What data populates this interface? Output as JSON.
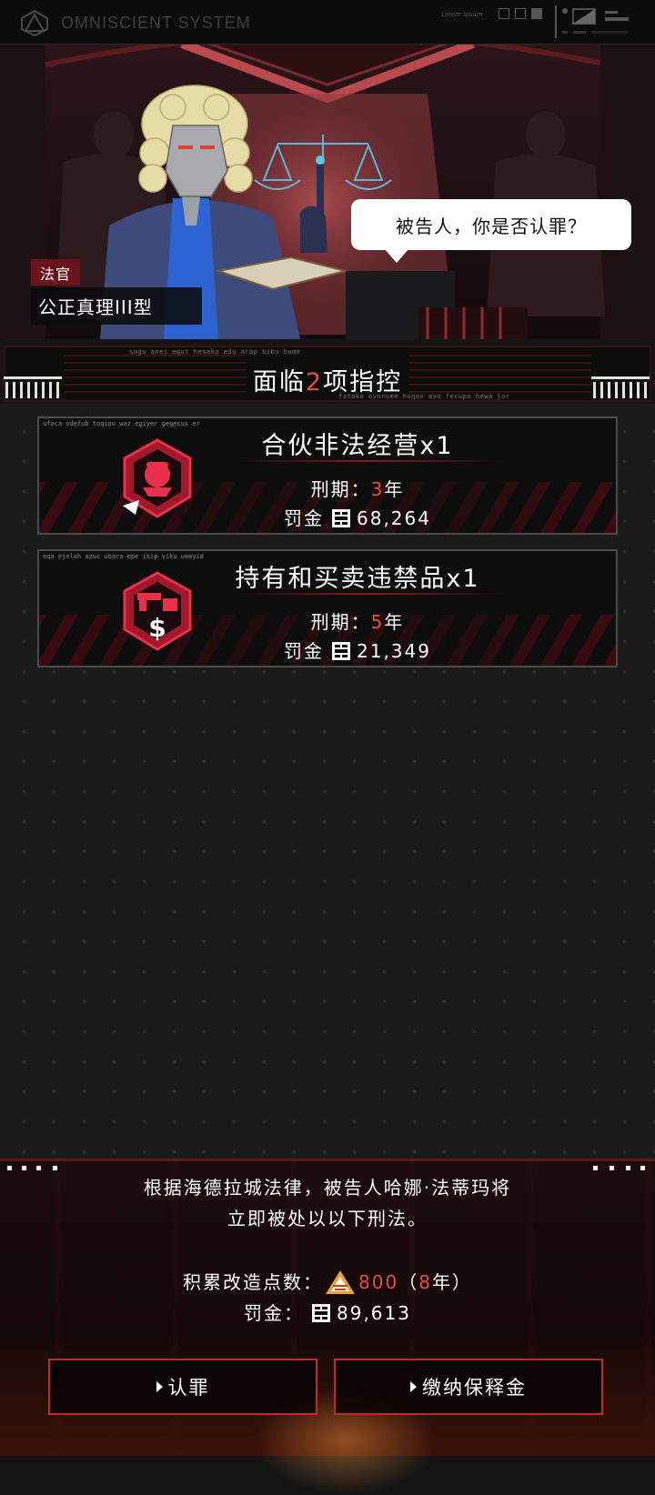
{
  "topbar": {
    "system_name": "OMNISCIENT SYSTEM",
    "lorem": "Lorem Ipsum"
  },
  "scene": {
    "speech": "被告人，你是否认罪？",
    "judge_role": "法官",
    "judge_name": "公正真理III型"
  },
  "charges_banner": {
    "prefix": "面临",
    "count": "2",
    "suffix": "项指控",
    "tiny_top": "sogu anej egut henaka edu arop bibu bume",
    "tiny_bottom": "fatoko ovorume hoqov evo fecupo hewa jor"
  },
  "charges": [
    {
      "tiny": "ufoca odefub toqipo waz egiyer gegecus er",
      "title": "合伙非法经营x1",
      "term_label": "刑期：",
      "term_years": "3",
      "term_unit": "年",
      "fine_label": "罚金",
      "fine_value": "68,264",
      "icon": "handshake-hex-icon"
    },
    {
      "tiny": "eqa ejeloh azuc ubara epe ikip viku uxeyid",
      "title": "持有和买卖违禁品x1",
      "term_label": "刑期：",
      "term_years": "5",
      "term_unit": "年",
      "fine_label": "罚金",
      "fine_value": "21,349",
      "icon": "contraband-hex-icon"
    }
  ],
  "verdict": {
    "line1": "根据海德拉城法律，被告人哈娜·法蒂玛将",
    "line2": "立即被处以以下刑法。",
    "points_label": "积累改造点数：",
    "points_value": "800",
    "points_open": "（",
    "points_years": "8",
    "points_close": "年）",
    "fine_label": "罚金：",
    "fine_value": "89,613"
  },
  "buttons": {
    "plead_guilty": "认罪",
    "pay_bail": "缴纳保释金"
  },
  "colors": {
    "accent": "#e5503c",
    "button_border": "#c02a1f",
    "card_border": "#4a4a4a",
    "stripe": "#3b0a0f"
  }
}
